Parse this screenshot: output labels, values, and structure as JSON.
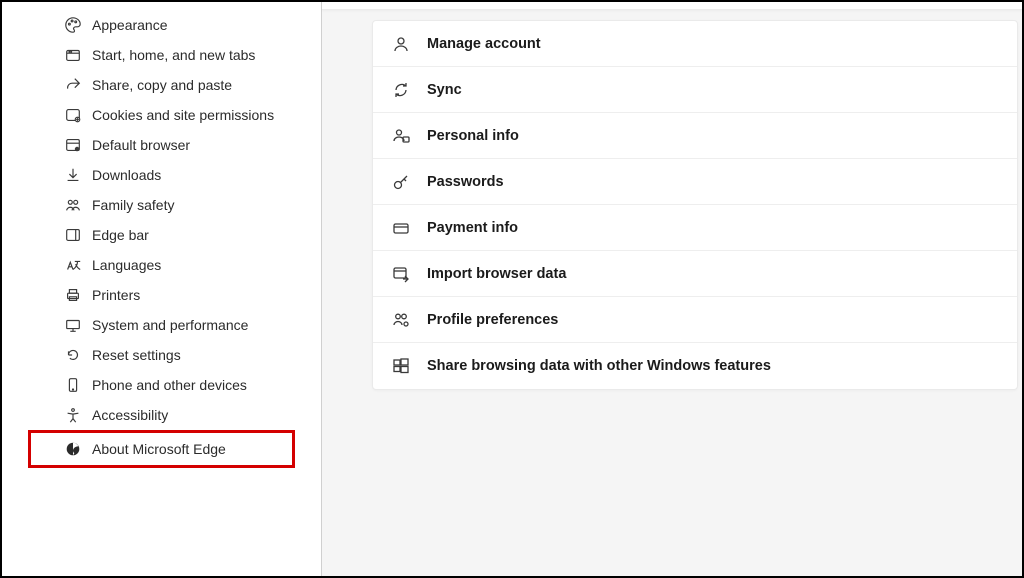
{
  "sidebar": {
    "items": [
      {
        "label": "Appearance",
        "icon": "palette-icon"
      },
      {
        "label": "Start, home, and new tabs",
        "icon": "tab-icon"
      },
      {
        "label": "Share, copy and paste",
        "icon": "share-icon"
      },
      {
        "label": "Cookies and site permissions",
        "icon": "cookie-icon"
      },
      {
        "label": "Default browser",
        "icon": "browser-icon"
      },
      {
        "label": "Downloads",
        "icon": "download-icon"
      },
      {
        "label": "Family safety",
        "icon": "family-icon"
      },
      {
        "label": "Edge bar",
        "icon": "edgebar-icon"
      },
      {
        "label": "Languages",
        "icon": "languages-icon"
      },
      {
        "label": "Printers",
        "icon": "printer-icon"
      },
      {
        "label": "System and performance",
        "icon": "system-icon"
      },
      {
        "label": "Reset settings",
        "icon": "reset-icon"
      },
      {
        "label": "Phone and other devices",
        "icon": "phone-icon"
      },
      {
        "label": "Accessibility",
        "icon": "accessibility-icon"
      },
      {
        "label": "About Microsoft Edge",
        "icon": "edge-icon"
      }
    ],
    "highlighted_index": 14
  },
  "main": {
    "rows": [
      {
        "label": "Manage account",
        "icon": "account-icon"
      },
      {
        "label": "Sync",
        "icon": "sync-icon"
      },
      {
        "label": "Personal info",
        "icon": "personal-info-icon"
      },
      {
        "label": "Passwords",
        "icon": "key-icon"
      },
      {
        "label": "Payment info",
        "icon": "card-icon"
      },
      {
        "label": "Import browser data",
        "icon": "import-icon"
      },
      {
        "label": "Profile preferences",
        "icon": "profile-pref-icon"
      },
      {
        "label": "Share browsing data with other Windows features",
        "icon": "windows-icon"
      }
    ]
  }
}
